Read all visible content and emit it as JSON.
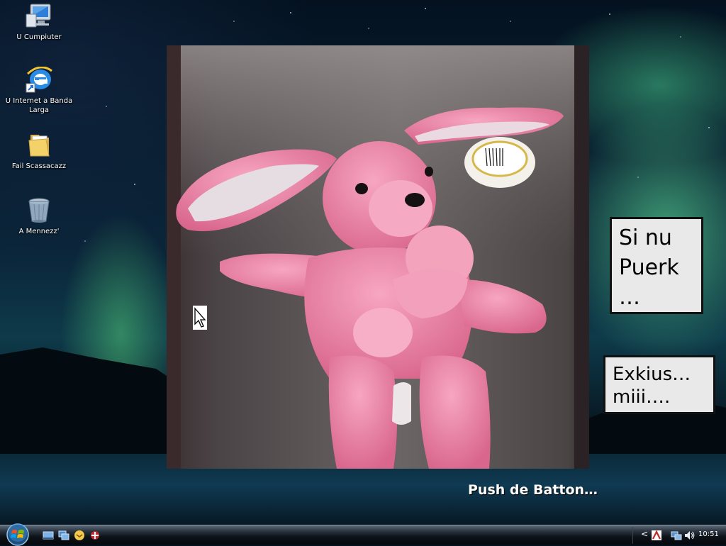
{
  "desktop": {
    "icons": [
      {
        "label": "U Cumpiuter",
        "icon": "computer-icon"
      },
      {
        "label": "U Internet a Banda Larga",
        "icon": "internet-explorer-icon"
      },
      {
        "label": "Fail Scassacazz",
        "icon": "folder-icon"
      },
      {
        "label": "A Mennezz'",
        "icon": "recycle-bin-icon"
      }
    ]
  },
  "photo": {
    "subject": "pink-plush-bunny-image"
  },
  "callouts": {
    "first": {
      "line1": "Si nu",
      "line2": "Puerk",
      "line3": "…"
    },
    "second": {
      "line1": "Exkius…",
      "line2": "miii…."
    }
  },
  "push_label": "Push de Batton…",
  "taskbar": {
    "start_icon": "windows-start-orb-icon",
    "quick_launch": [
      "show-desktop-icon",
      "switch-windows-icon",
      "messenger-icon",
      "antivirus-icon"
    ],
    "tray_icons": [
      "show-hidden-chevron-icon",
      "antivirus-tray-icon",
      "network-icon",
      "volume-icon"
    ],
    "tray_chevron": "<",
    "clock": "10:51"
  },
  "colors": {
    "callout_bg": "#e9e9e9",
    "callout_border": "#111111",
    "bunny_pink": "#f08aa8",
    "aurora_green": "#5adc96"
  }
}
